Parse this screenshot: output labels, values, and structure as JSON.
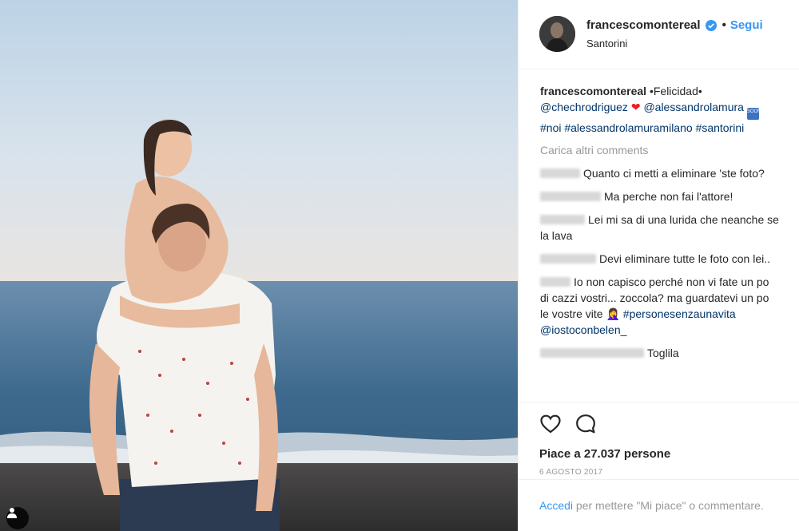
{
  "post": {
    "username": "francescomontereal",
    "follow_label": "Segui",
    "location": "Santorini",
    "caption": {
      "username": "francescomontereal",
      "text": " •Felicidad• ",
      "mention1": "@chechrodriguez",
      "heart": "❤",
      "mention2": "@alessandrolamura",
      "soon_badge": "SOON",
      "tag1": "#noi",
      "tag2": "#alessandrolamuramilano",
      "tag3": "#santorini"
    },
    "load_more": "Carica altri comments",
    "comments": [
      {
        "text": "Quanto ci metti a eliminare 'ste foto?"
      },
      {
        "text": "Ma perche non fai l'attore!"
      },
      {
        "text": "Lei mi sa di una lurida che neanche se la lava"
      },
      {
        "text": "Devi eliminare tutte le foto con lei.."
      },
      {
        "text": "Io non capisco perché non vi fate un po di cazzi vostri... zoccola? ma guardatevi un po le vostre vite 🤦‍♀️ ",
        "tag": "#personesenzaunavita",
        "mention": "@iostoconbelen_"
      },
      {
        "text": "Toglila"
      }
    ],
    "likes": "Piace a 27.037 persone",
    "date": "6 AGOSTO 2017",
    "login": {
      "link": "Accedi",
      "rest": " per mettere \"Mi piace\" o commentare."
    },
    "icons": {
      "like": "heart-outline-icon",
      "comment": "speech-bubble-icon",
      "tag": "person-tag-icon",
      "verified": "verified-badge-icon"
    },
    "colors": {
      "link_blue": "#3897f0",
      "mention_navy": "#003569",
      "muted": "#999999",
      "verified": "#3897f0"
    }
  }
}
